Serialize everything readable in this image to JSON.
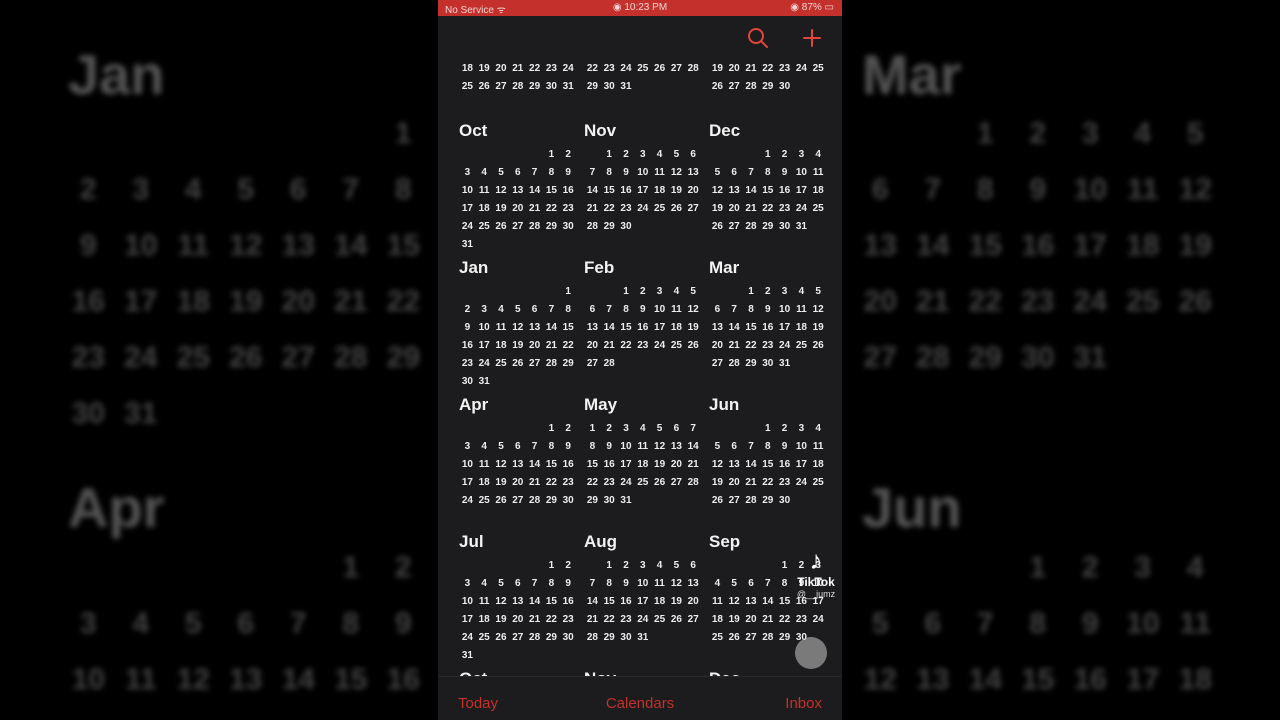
{
  "status_bar": {
    "carrier": "No Service ᯤ",
    "time": "◉ 10:23 PM",
    "battery": "◉ 87% ▭"
  },
  "toolbar": {
    "search_icon": "search-icon",
    "add_icon": "plus-icon"
  },
  "tabs": {
    "today": "Today",
    "calendars": "Calendars",
    "inbox": "Inbox"
  },
  "watermark": {
    "brand": "TikTok",
    "user": "@__jumz"
  },
  "partial_top": [
    {
      "name": "",
      "offset": 0,
      "days": 31,
      "start": 18
    },
    {
      "name": "",
      "offset": 0,
      "days": 31,
      "start": 22
    },
    {
      "name": "",
      "offset": 0,
      "days": 30,
      "start": 19
    }
  ],
  "months": [
    {
      "name": "Oct",
      "offset": 5,
      "days": 31
    },
    {
      "name": "Nov",
      "offset": 1,
      "days": 30
    },
    {
      "name": "Dec",
      "offset": 3,
      "days": 31
    },
    {
      "name": "Jan",
      "offset": 6,
      "days": 31
    },
    {
      "name": "Feb",
      "offset": 2,
      "days": 28
    },
    {
      "name": "Mar",
      "offset": 2,
      "days": 31
    },
    {
      "name": "Apr",
      "offset": 5,
      "days": 30
    },
    {
      "name": "May",
      "offset": 0,
      "days": 31
    },
    {
      "name": "Jun",
      "offset": 3,
      "days": 30
    },
    {
      "name": "Jul",
      "offset": 5,
      "days": 31
    },
    {
      "name": "Aug",
      "offset": 1,
      "days": 31
    },
    {
      "name": "Sep",
      "offset": 4,
      "days": 30
    }
  ],
  "partial_bottom": [
    "Oct",
    "Nov",
    "Dec"
  ],
  "background": {
    "left_month_1": "Jan",
    "left_month_2": "Apr",
    "right_month_1": "Mar",
    "right_month_2": "Jun"
  }
}
